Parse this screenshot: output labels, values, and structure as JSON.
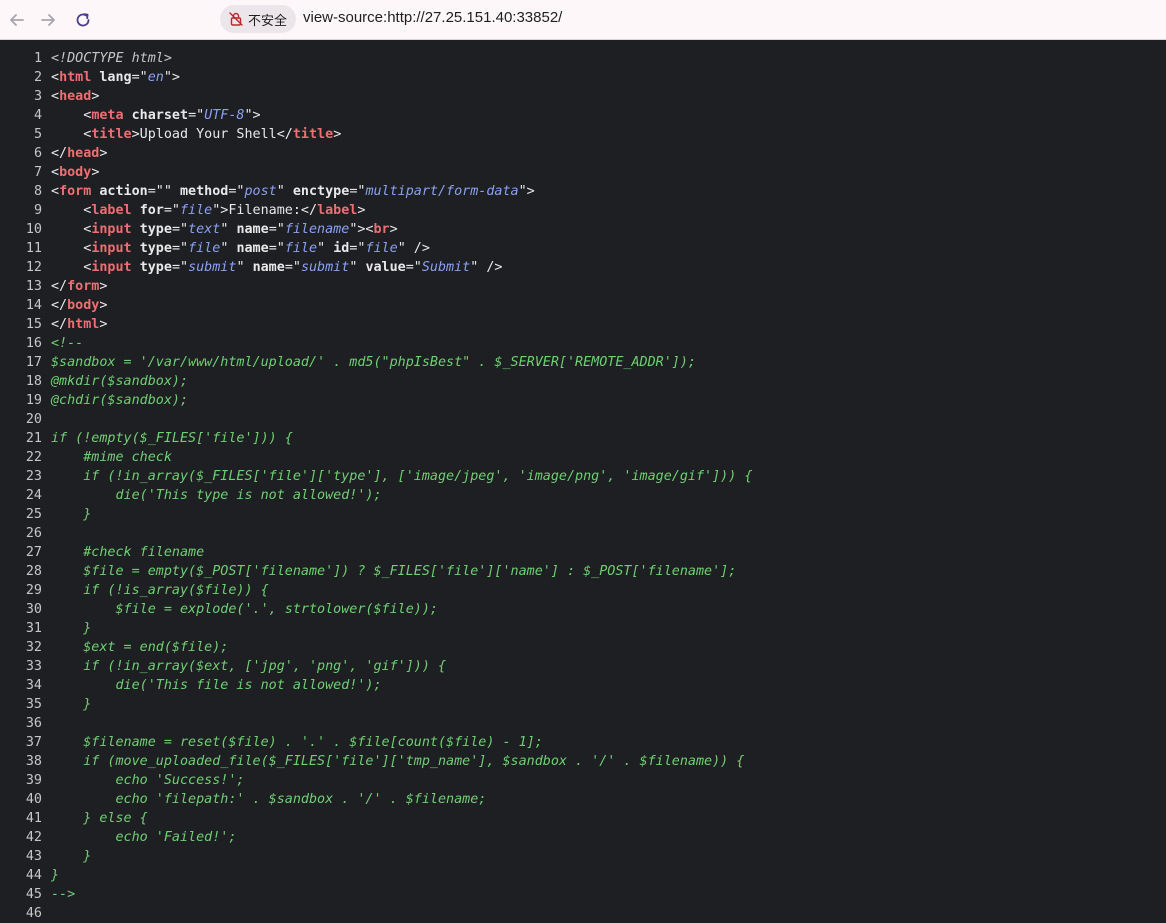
{
  "browser": {
    "security_label": "不安全",
    "url": "view-source:http://27.25.151.40:33852/"
  },
  "source_lines": [
    [
      [
        "dt",
        "<!DOCTYPE html>"
      ]
    ],
    [
      [
        "txt",
        "<"
      ],
      [
        "tag",
        "html"
      ],
      [
        "txt",
        " "
      ],
      [
        "attr",
        "lang"
      ],
      [
        "txt",
        "=\""
      ],
      [
        "val",
        "en"
      ],
      [
        "txt",
        "\">"
      ]
    ],
    [
      [
        "txt",
        "<"
      ],
      [
        "tag",
        "head"
      ],
      [
        "txt",
        ">"
      ]
    ],
    [
      [
        "txt",
        "    <"
      ],
      [
        "tag",
        "meta"
      ],
      [
        "txt",
        " "
      ],
      [
        "attr",
        "charset"
      ],
      [
        "txt",
        "=\""
      ],
      [
        "val",
        "UTF-8"
      ],
      [
        "txt",
        "\">"
      ]
    ],
    [
      [
        "txt",
        "    <"
      ],
      [
        "tag",
        "title"
      ],
      [
        "txt",
        ">Upload Your Shell</"
      ],
      [
        "tag",
        "title"
      ],
      [
        "txt",
        ">"
      ]
    ],
    [
      [
        "txt",
        "</"
      ],
      [
        "tag",
        "head"
      ],
      [
        "txt",
        ">"
      ]
    ],
    [
      [
        "txt",
        "<"
      ],
      [
        "tag",
        "body"
      ],
      [
        "txt",
        ">"
      ]
    ],
    [
      [
        "txt",
        "<"
      ],
      [
        "tag",
        "form"
      ],
      [
        "txt",
        " "
      ],
      [
        "attr",
        "action"
      ],
      [
        "txt",
        "=\"\" "
      ],
      [
        "attr",
        "method"
      ],
      [
        "txt",
        "=\""
      ],
      [
        "val",
        "post"
      ],
      [
        "txt",
        "\" "
      ],
      [
        "attr",
        "enctype"
      ],
      [
        "txt",
        "=\""
      ],
      [
        "val",
        "multipart/form-data"
      ],
      [
        "txt",
        "\">"
      ]
    ],
    [
      [
        "txt",
        "    <"
      ],
      [
        "tag",
        "label"
      ],
      [
        "txt",
        " "
      ],
      [
        "attr",
        "for"
      ],
      [
        "txt",
        "=\""
      ],
      [
        "val",
        "file"
      ],
      [
        "txt",
        "\">Filename:</"
      ],
      [
        "tag",
        "label"
      ],
      [
        "txt",
        ">"
      ]
    ],
    [
      [
        "txt",
        "    <"
      ],
      [
        "tag",
        "input"
      ],
      [
        "txt",
        " "
      ],
      [
        "attr",
        "type"
      ],
      [
        "txt",
        "=\""
      ],
      [
        "val",
        "text"
      ],
      [
        "txt",
        "\" "
      ],
      [
        "attr",
        "name"
      ],
      [
        "txt",
        "=\""
      ],
      [
        "val",
        "filename"
      ],
      [
        "txt",
        "\"><"
      ],
      [
        "tag",
        "br"
      ],
      [
        "txt",
        ">"
      ]
    ],
    [
      [
        "txt",
        "    <"
      ],
      [
        "tag",
        "input"
      ],
      [
        "txt",
        " "
      ],
      [
        "attr",
        "type"
      ],
      [
        "txt",
        "=\""
      ],
      [
        "val",
        "file"
      ],
      [
        "txt",
        "\" "
      ],
      [
        "attr",
        "name"
      ],
      [
        "txt",
        "=\""
      ],
      [
        "val",
        "file"
      ],
      [
        "txt",
        "\" "
      ],
      [
        "attr",
        "id"
      ],
      [
        "txt",
        "=\""
      ],
      [
        "val",
        "file"
      ],
      [
        "txt",
        "\" />"
      ]
    ],
    [
      [
        "txt",
        "    <"
      ],
      [
        "tag",
        "input"
      ],
      [
        "txt",
        " "
      ],
      [
        "attr",
        "type"
      ],
      [
        "txt",
        "=\""
      ],
      [
        "val",
        "submit"
      ],
      [
        "txt",
        "\" "
      ],
      [
        "attr",
        "name"
      ],
      [
        "txt",
        "=\""
      ],
      [
        "val",
        "submit"
      ],
      [
        "txt",
        "\" "
      ],
      [
        "attr",
        "value"
      ],
      [
        "txt",
        "=\""
      ],
      [
        "val",
        "Submit"
      ],
      [
        "txt",
        "\" />"
      ]
    ],
    [
      [
        "txt",
        "</"
      ],
      [
        "tag",
        "form"
      ],
      [
        "txt",
        ">"
      ]
    ],
    [
      [
        "txt",
        "</"
      ],
      [
        "tag",
        "body"
      ],
      [
        "txt",
        ">"
      ]
    ],
    [
      [
        "txt",
        "</"
      ],
      [
        "tag",
        "html"
      ],
      [
        "txt",
        ">"
      ]
    ],
    [
      [
        "cmt",
        "<!--"
      ]
    ],
    [
      [
        "cmt",
        "$sandbox = '/var/www/html/upload/' . md5(\"phpIsBest\" . $_SERVER['REMOTE_ADDR']);"
      ]
    ],
    [
      [
        "cmt",
        "@mkdir($sandbox);"
      ]
    ],
    [
      [
        "cmt",
        "@chdir($sandbox);"
      ]
    ],
    [
      [
        "cmt",
        ""
      ]
    ],
    [
      [
        "cmt",
        "if (!empty($_FILES['file'])) {"
      ]
    ],
    [
      [
        "cmt",
        "    #mime check"
      ]
    ],
    [
      [
        "cmt",
        "    if (!in_array($_FILES['file']['type'], ['image/jpeg', 'image/png', 'image/gif'])) {"
      ]
    ],
    [
      [
        "cmt",
        "        die('This type is not allowed!');"
      ]
    ],
    [
      [
        "cmt",
        "    }"
      ]
    ],
    [
      [
        "cmt",
        ""
      ]
    ],
    [
      [
        "cmt",
        "    #check filename"
      ]
    ],
    [
      [
        "cmt",
        "    $file = empty($_POST['filename']) ? $_FILES['file']['name'] : $_POST['filename'];"
      ]
    ],
    [
      [
        "cmt",
        "    if (!is_array($file)) {"
      ]
    ],
    [
      [
        "cmt",
        "        $file = explode('.', strtolower($file));"
      ]
    ],
    [
      [
        "cmt",
        "    }"
      ]
    ],
    [
      [
        "cmt",
        "    $ext = end($file);"
      ]
    ],
    [
      [
        "cmt",
        "    if (!in_array($ext, ['jpg', 'png', 'gif'])) {"
      ]
    ],
    [
      [
        "cmt",
        "        die('This file is not allowed!');"
      ]
    ],
    [
      [
        "cmt",
        "    }"
      ]
    ],
    [
      [
        "cmt",
        ""
      ]
    ],
    [
      [
        "cmt",
        "    $filename = reset($file) . '.' . $file[count($file) - 1];"
      ]
    ],
    [
      [
        "cmt",
        "    if (move_uploaded_file($_FILES['file']['tmp_name'], $sandbox . '/' . $filename)) {"
      ]
    ],
    [
      [
        "cmt",
        "        echo 'Success!';"
      ]
    ],
    [
      [
        "cmt",
        "        echo 'filepath:' . $sandbox . '/' . $filename;"
      ]
    ],
    [
      [
        "cmt",
        "    } else {"
      ]
    ],
    [
      [
        "cmt",
        "        echo 'Failed!';"
      ]
    ],
    [
      [
        "cmt",
        "    }"
      ]
    ],
    [
      [
        "cmt",
        "}"
      ]
    ],
    [
      [
        "cmt",
        "-->"
      ]
    ],
    [
      [
        "txt",
        ""
      ]
    ]
  ]
}
